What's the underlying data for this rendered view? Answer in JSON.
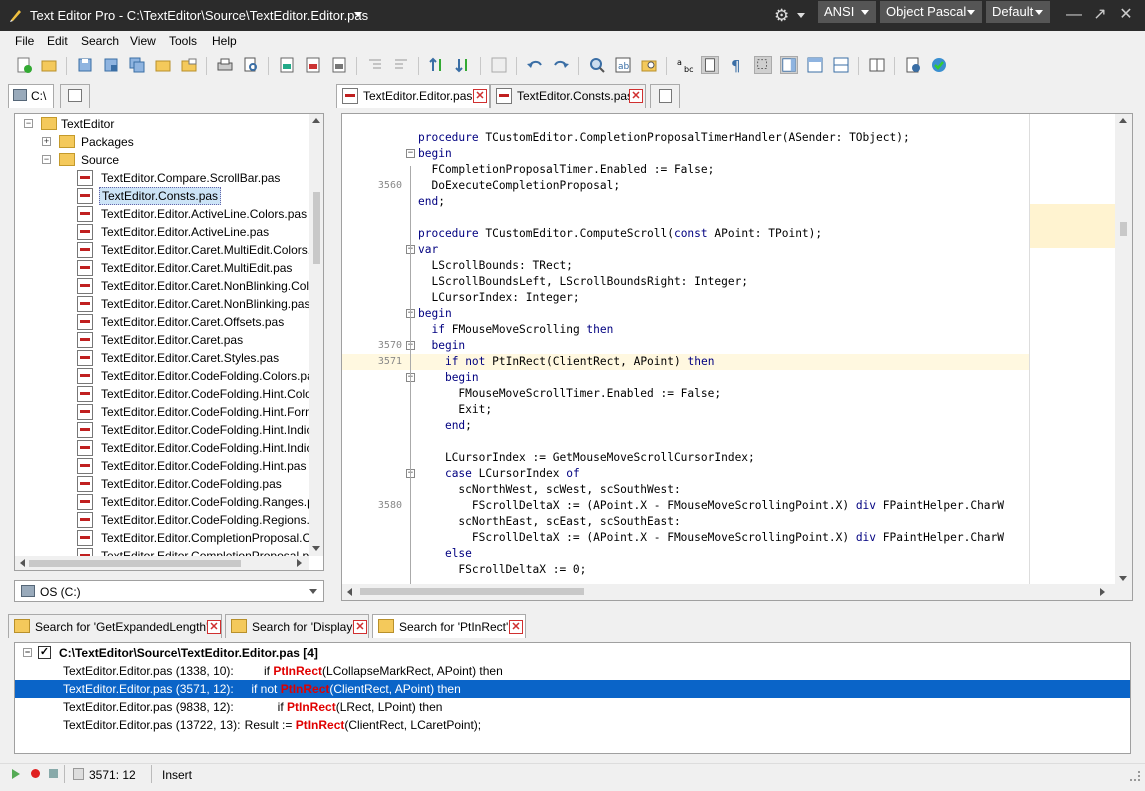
{
  "window": {
    "title": "Text Editor Pro  -  C:\\TextEditor\\Source\\TextEditor.Editor.pas",
    "encoding": "ANSI",
    "highlighter": "Object Pascal",
    "skin": "Default"
  },
  "menu": [
    "File",
    "Edit",
    "Search",
    "View",
    "Tools",
    "Help"
  ],
  "left_panel": {
    "tab_label": "C:\\",
    "tree": {
      "root": "TextEditor",
      "folders": [
        "Packages",
        "Source"
      ],
      "files": [
        "TextEditor.Compare.ScrollBar.pas",
        "TextEditor.Consts.pas",
        "TextEditor.Editor.ActiveLine.Colors.pas",
        "TextEditor.Editor.ActiveLine.pas",
        "TextEditor.Editor.Caret.MultiEdit.Colors.pas",
        "TextEditor.Editor.Caret.MultiEdit.pas",
        "TextEditor.Editor.Caret.NonBlinking.Colors",
        "TextEditor.Editor.Caret.NonBlinking.pas",
        "TextEditor.Editor.Caret.Offsets.pas",
        "TextEditor.Editor.Caret.pas",
        "TextEditor.Editor.Caret.Styles.pas",
        "TextEditor.Editor.CodeFolding.Colors.pas",
        "TextEditor.Editor.CodeFolding.Hint.Colors.",
        "TextEditor.Editor.CodeFolding.Hint.Form.p",
        "TextEditor.Editor.CodeFolding.Hint.Indicat",
        "TextEditor.Editor.CodeFolding.Hint.Indicat",
        "TextEditor.Editor.CodeFolding.Hint.pas",
        "TextEditor.Editor.CodeFolding.pas",
        "TextEditor.Editor.CodeFolding.Ranges.pas",
        "TextEditor.Editor.CodeFolding.Regions.pas",
        "TextEditor.Editor.CompletionProposal.Colo",
        "TextEditor.Editor.CompletionProposal.pas"
      ],
      "selected_index": 1
    },
    "drive": "OS (C:)"
  },
  "editor": {
    "tabs": [
      "TextEditor.Editor.pas",
      "TextEditor.Consts.pas"
    ],
    "lines": [
      {
        "num": "",
        "text": "procedure TCustomEditor.CompletionProposalTimerHandler(ASender: TObject);",
        "fold": ""
      },
      {
        "num": "",
        "text": "begin",
        "fold": "-"
      },
      {
        "num": "",
        "text": "  FCompletionProposalTimer.Enabled := False;",
        "fold": ""
      },
      {
        "num": "3560",
        "text": "  DoExecuteCompletionProposal;",
        "fold": ""
      },
      {
        "num": "",
        "text": "end;",
        "fold": ""
      },
      {
        "num": "",
        "text": "",
        "fold": ""
      },
      {
        "num": "",
        "text": "procedure TCustomEditor.ComputeScroll(const APoint: TPoint);",
        "fold": ""
      },
      {
        "num": "",
        "text": "var",
        "fold": "-"
      },
      {
        "num": "",
        "text": "  LScrollBounds: TRect;",
        "fold": ""
      },
      {
        "num": "",
        "text": "  LScrollBoundsLeft, LScrollBoundsRight: Integer;",
        "fold": ""
      },
      {
        "num": "",
        "text": "  LCursorIndex: Integer;",
        "fold": ""
      },
      {
        "num": "",
        "text": "begin",
        "fold": "-"
      },
      {
        "num": "",
        "text": "  if FMouseMoveScrolling then",
        "fold": ""
      },
      {
        "num": "3570",
        "text": "  begin",
        "fold": "-"
      },
      {
        "num": "3571",
        "text": "    if not PtInRect(ClientRect, APoint) then",
        "fold": ""
      },
      {
        "num": "",
        "text": "    begin",
        "fold": "-"
      },
      {
        "num": "",
        "text": "      FMouseMoveScrollTimer.Enabled := False;",
        "fold": ""
      },
      {
        "num": "",
        "text": "      Exit;",
        "fold": ""
      },
      {
        "num": "",
        "text": "    end;",
        "fold": ""
      },
      {
        "num": "",
        "text": "",
        "fold": ""
      },
      {
        "num": "",
        "text": "    LCursorIndex := GetMouseMoveScrollCursorIndex;",
        "fold": ""
      },
      {
        "num": "",
        "text": "    case LCursorIndex of",
        "fold": "-"
      },
      {
        "num": "",
        "text": "      scNorthWest, scWest, scSouthWest:",
        "fold": ""
      },
      {
        "num": "3580",
        "text": "        FScrollDeltaX := (APoint.X - FMouseMoveScrollingPoint.X) div FPaintHelper.CharW",
        "fold": ""
      },
      {
        "num": "",
        "text": "      scNorthEast, scEast, scSouthEast:",
        "fold": ""
      },
      {
        "num": "",
        "text": "        FScrollDeltaX := (APoint.X - FMouseMoveScrollingPoint.X) div FPaintHelper.CharW",
        "fold": ""
      },
      {
        "num": "",
        "text": "    else",
        "fold": ""
      },
      {
        "num": "",
        "text": "      FScrollDeltaX := 0;",
        "fold": ""
      }
    ],
    "active_line_index": 14
  },
  "search": {
    "tabs": [
      "Search for 'GetExpandedLength'",
      "Search for 'Display'",
      "Search for 'PtInRect'"
    ],
    "group": "C:\\TextEditor\\Source\\TextEditor.Editor.pas [4]",
    "results": [
      {
        "file": "TextEditor.Editor.pas (1338, 10):",
        "pre": "      if ",
        "match": "PtInRect",
        "post": "(LCollapseMarkRect, APoint) then"
      },
      {
        "file": "TextEditor.Editor.pas (3571, 12):",
        "pre": "    if not ",
        "match": "PtInRect",
        "post": "(ClientRect, APoint) then"
      },
      {
        "file": "TextEditor.Editor.pas (9838, 12):",
        "pre": "        if ",
        "match": "PtInRect",
        "post": "(LRect, LPoint) then"
      },
      {
        "file": "TextEditor.Editor.pas (13722, 13):",
        "pre": "  Result := ",
        "match": "PtInRect",
        "post": "(ClientRect, LCaretPoint);"
      }
    ],
    "selected_index": 1
  },
  "status": {
    "position": "3571: 12",
    "mode": "Insert"
  }
}
